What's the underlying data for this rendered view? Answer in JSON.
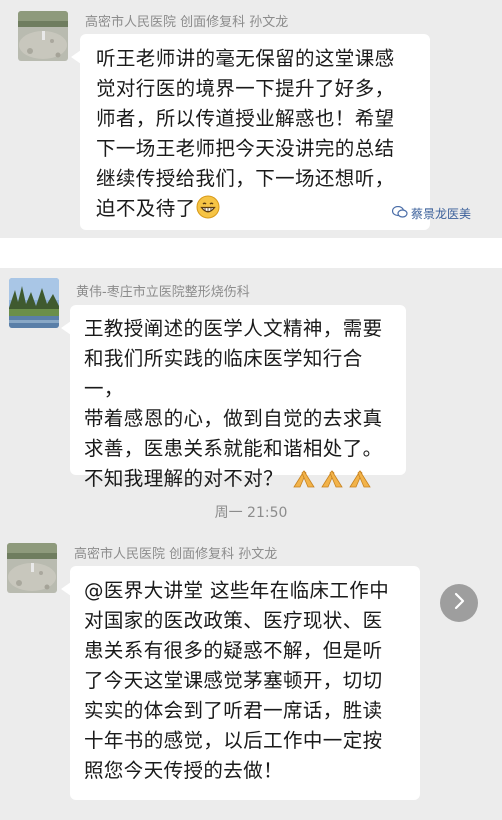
{
  "messages": [
    {
      "sender": "高密市人民医院 创面修复科 孙文龙",
      "lines": [
        "听王老师讲的毫无保留的这堂课感",
        "觉对行医的境界一下提升了好多，",
        "师者，所以传道授业解惑也！希望",
        "下一场王老师把今天没讲完的总结",
        "继续传授给我们，下一场还想听，",
        "迫不及待了"
      ],
      "emoji": "grinning-face"
    },
    {
      "sender": "黄伟-枣庄市立医院整形烧伤科",
      "lines": [
        "王教授阐述的医学人文精神，需要",
        "和我们所实践的临床医学知行合一，",
        "带着感恩的心，做到自觉的去求真",
        "求善，医患关系就能和谐相处了。",
        "不知我理解的对不对？"
      ],
      "emoji": "praying-hands"
    },
    {
      "sender": "高密市人民医院 创面修复科 孙文龙",
      "lines": [
        "@医界大讲堂  这些年在临床工作中",
        "对国家的医改政策、医疗现状、医",
        "患关系有很多的疑惑不解，但是听",
        "了今天这堂课感觉茅塞顿开，切切",
        "实实的体会到了听君一席话，胜读",
        "十年书的感觉，以后工作中一定按",
        "照您今天传授的去做！"
      ]
    }
  ],
  "timestamp": "周一 21:50",
  "watermark": "蔡景龙医美"
}
